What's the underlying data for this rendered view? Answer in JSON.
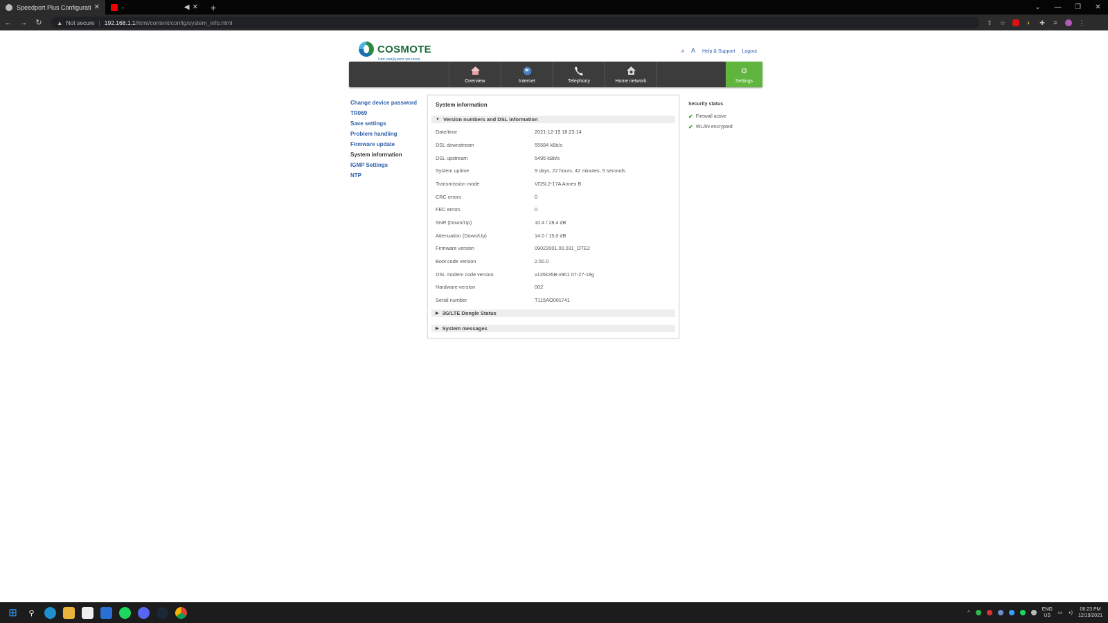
{
  "browser": {
    "tabs": [
      {
        "title": "Speedport Plus Configuration Pr",
        "favicon_color": "#dddddd"
      },
      {
        "title": "-",
        "favicon_color": "#ff0000"
      }
    ],
    "new_tab": "+",
    "omnibox": {
      "security": "Not secure",
      "host": "192.168.1.1",
      "path": "/html/content/config/system_info.html"
    }
  },
  "header": {
    "logo_text": "COSMOTE",
    "logo_tagline": "Γιατί νοιαζόμαστε για εσένα",
    "font_small": "A",
    "font_large": "A",
    "help": "Help & Support",
    "logout": "Logout"
  },
  "nav": {
    "items": [
      {
        "label": "Overview",
        "icon": "home-icon"
      },
      {
        "label": "Internet",
        "icon": "globe-icon"
      },
      {
        "label": "Telephony",
        "icon": "phone-icon"
      },
      {
        "label": "Home network",
        "icon": "house-network-icon"
      },
      {
        "label": "Settings",
        "icon": "gear-icon"
      }
    ],
    "active_color": "#5fb53d"
  },
  "sidebar": {
    "items": [
      {
        "label": "Change device password"
      },
      {
        "label": "TR069"
      },
      {
        "label": "Save settings"
      },
      {
        "label": "Problem handling"
      },
      {
        "label": "Firmware update"
      },
      {
        "label": "System information"
      },
      {
        "label": "IGMP Settings"
      },
      {
        "label": "NTP"
      }
    ]
  },
  "main": {
    "title": "System information",
    "section1": "Version numbers and DSL information",
    "rows": [
      {
        "label": "Date/time",
        "value": "2021-12-19 18:23:14"
      },
      {
        "label": "DSL downstream",
        "value": "55584 kBit/s"
      },
      {
        "label": "DSL upstream",
        "value": "5495 kBit/s"
      },
      {
        "label": "System uptime",
        "value": "9 days, 22 hours, 42 minutes, 5 seconds"
      },
      {
        "label": "Transmission mode",
        "value": "VDSL2-17A Annex B"
      },
      {
        "label": "CRC errors",
        "value": "0"
      },
      {
        "label": "FEC errors",
        "value": "0"
      },
      {
        "label": "SNR (Down/Up)",
        "value": "10.4 / 28.4 dB"
      },
      {
        "label": "Attenuation (Down/Up)",
        "value": "14.0 / 15.0 dB"
      },
      {
        "label": "Firmware version",
        "value": "09022001.00.031_OTE2"
      },
      {
        "label": "Boot code version",
        "value": "2.50.0"
      },
      {
        "label": "DSL modem code version",
        "value": "v135k35B-v901 07-27-18g"
      },
      {
        "label": "Hardware version",
        "value": "002"
      },
      {
        "label": "Serial number",
        "value": "T115AO001741"
      }
    ],
    "section2": "3G/LTE Dongle Status",
    "section3": "System messages"
  },
  "security": {
    "title": "Security status",
    "items": [
      "Firewall active",
      "WLAN encrypted"
    ]
  },
  "taskbar": {
    "lang1": "ENG",
    "lang2": "US",
    "time": "06:23 PM",
    "date": "12/19/2021"
  }
}
